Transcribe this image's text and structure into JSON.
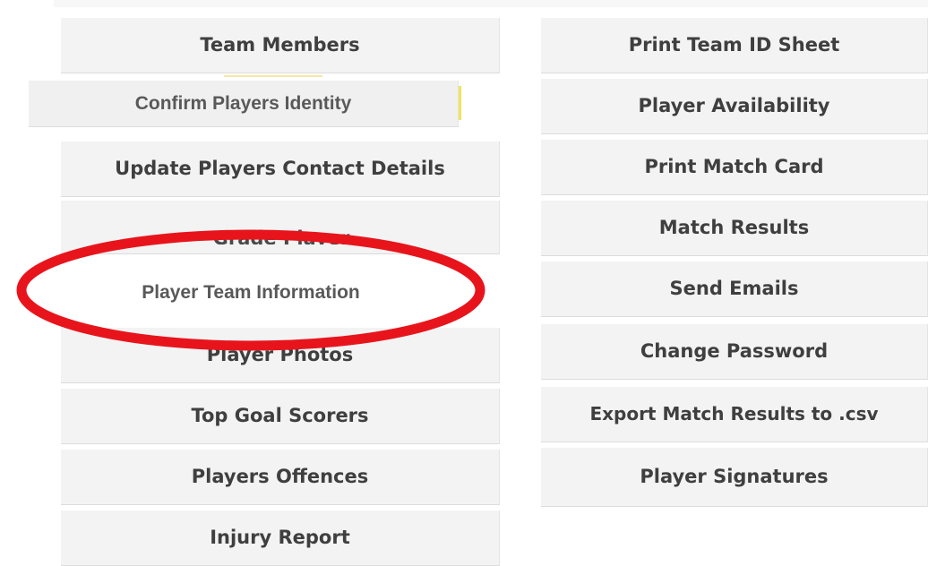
{
  "left_menu": [
    {
      "label": "Team Members"
    },
    {
      "label": "Update Players Contact Details"
    },
    {
      "label": "Player Photos"
    },
    {
      "label": "Top Goal Scorers"
    },
    {
      "label": "Players Offences"
    },
    {
      "label": "Injury Report"
    }
  ],
  "left_special": {
    "confirm": "Confirm Players Identity",
    "grade": "Grade Player",
    "team_info": "Player Team Information"
  },
  "right_menu": [
    {
      "label": "Print Team ID Sheet"
    },
    {
      "label": "Player Availability"
    },
    {
      "label": "Print Match Card"
    },
    {
      "label": "Match Results"
    },
    {
      "label": "Send Emails"
    },
    {
      "label": "Change Password"
    },
    {
      "label": "Export Match Results to .csv"
    },
    {
      "label": "Player Signatures"
    }
  ],
  "colors": {
    "annotation": "#e8141c",
    "button_bg": "#f3f3f3",
    "text": "#3f3f3f",
    "highlight": "#f2e35a"
  }
}
